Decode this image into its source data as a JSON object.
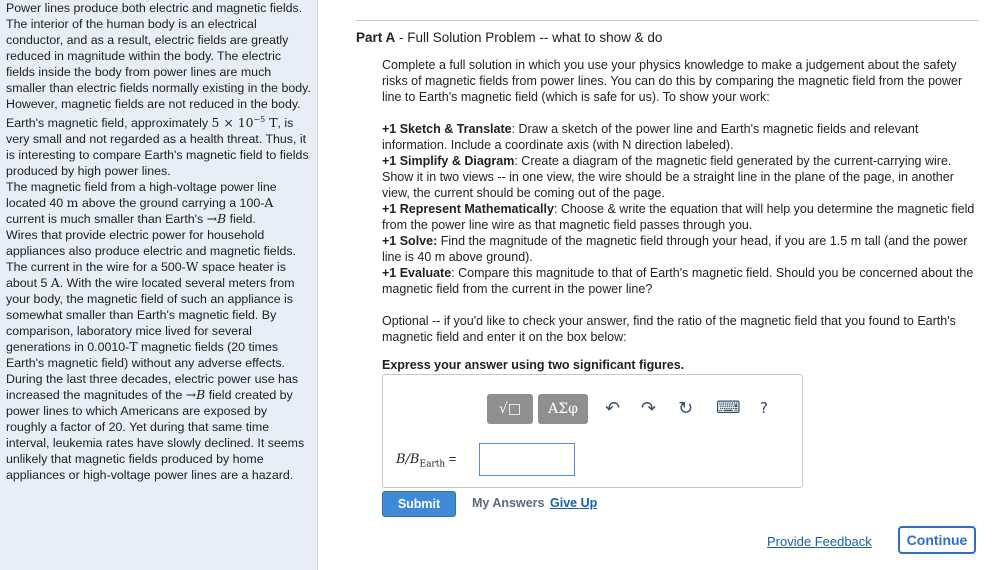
{
  "left": {
    "paragraphs": [
      "Power lines produce both electric and magnetic fields. The interior of the human body is an electrical conductor, and as a result, electric fields are greatly reduced in magnitude within the body. The electric fields inside the body from power lines are much smaller than electric fields normally existing in the body.",
      "However, magnetic fields are not reduced in the body. Earth's magnetic field, approximately",
      "5 × 10",
      "−5",
      " T",
      ", is very small and not regarded as a health threat. Thus, it is interesting to compare Earth's magnetic field to fields produced by high power lines.",
      "The magnetic field from a high-voltage power line located 40 ",
      "m",
      " above the ground carrying a 100-",
      "A",
      " current is much smaller than Earth's ",
      "B",
      " field.",
      "Wires that provide electric power for household appliances also produce electric and magnetic fields. The current in the wire for a 500-",
      "W",
      " space heater is about 5 ",
      "A",
      ". With the wire located several meters from your body, the magnetic field of such an appliance is somewhat smaller than Earth's magnetic field. By comparison, laboratory mice lived for several generations in 0.0010-",
      "T",
      " magnetic fields (20 times Earth's magnetic field) without any adverse effects.",
      "During the last three decades, electric power use has increased the magnitudes of the ",
      "B",
      " field created by power lines to which Americans are exposed by roughly a factor of 20. Yet during that same time interval, leukemia rates have slowly declined. It seems unlikely that magnetic fields produced by home appliances or high-voltage power lines are a hazard."
    ]
  },
  "part": {
    "label": "Part A",
    "title": " - Full Solution Problem -- what to show & do"
  },
  "content": {
    "intro": "Complete a full solution in which you use your physics knowledge to make a judgement about the safety risks of magnetic fields from power lines. You can do this by comparing the magnetic field from the power line to Earth's magnetic field (which is safe for us). To show your work:",
    "steps": [
      {
        "bold": "+1 Sketch & Translate",
        "text": ": Draw a sketch of the power line and Earth's magnetic fields and relevant information. Include a coordinate axis (with N direction labeled)."
      },
      {
        "bold": "+1 Simplify & Diagram",
        "text": ": Create a diagram of the magnetic field generated by the current-carrying wire. Show it in two views -- in one view, the wire should be a straight line in the plane of the page, in another view, the current should be coming out of the page."
      },
      {
        "bold": "+1 Represent Mathematically",
        "text": ": Choose & write the equation that will help you determine the magnetic field from the power line wire as that magnetic field passes through you."
      },
      {
        "bold": "+1 Solve:",
        "text": " Find the magnitude of the magnetic field through your head, if you are 1.5 m tall (and the power line is 40 m above ground)."
      },
      {
        "bold": "+1 Evaluate",
        "text": ": Compare this magnitude to that of Earth's magnetic field. Should you be concerned about the magnetic field from the current in the power line?"
      }
    ],
    "optional": "Optional -- if you'd like to check your answer, find the ratio of the magnetic field that you found to Earth's magnetic field and enter it on the box below:",
    "express": "Express your answer using two significant figures."
  },
  "toolbar": {
    "template_label": "√□",
    "symbols_label": "ΑΣφ",
    "undo": "↶",
    "redo": "↷",
    "reset": "↻",
    "keyboard": "⌨",
    "help": "?"
  },
  "answer": {
    "label_main": "B/B",
    "label_sub": "Earth",
    "label_eq": " =",
    "value": ""
  },
  "actions": {
    "submit": "Submit",
    "my_answers": "My Answers",
    "give_up": "Give Up",
    "feedback": "Provide Feedback",
    "continue": "Continue"
  }
}
